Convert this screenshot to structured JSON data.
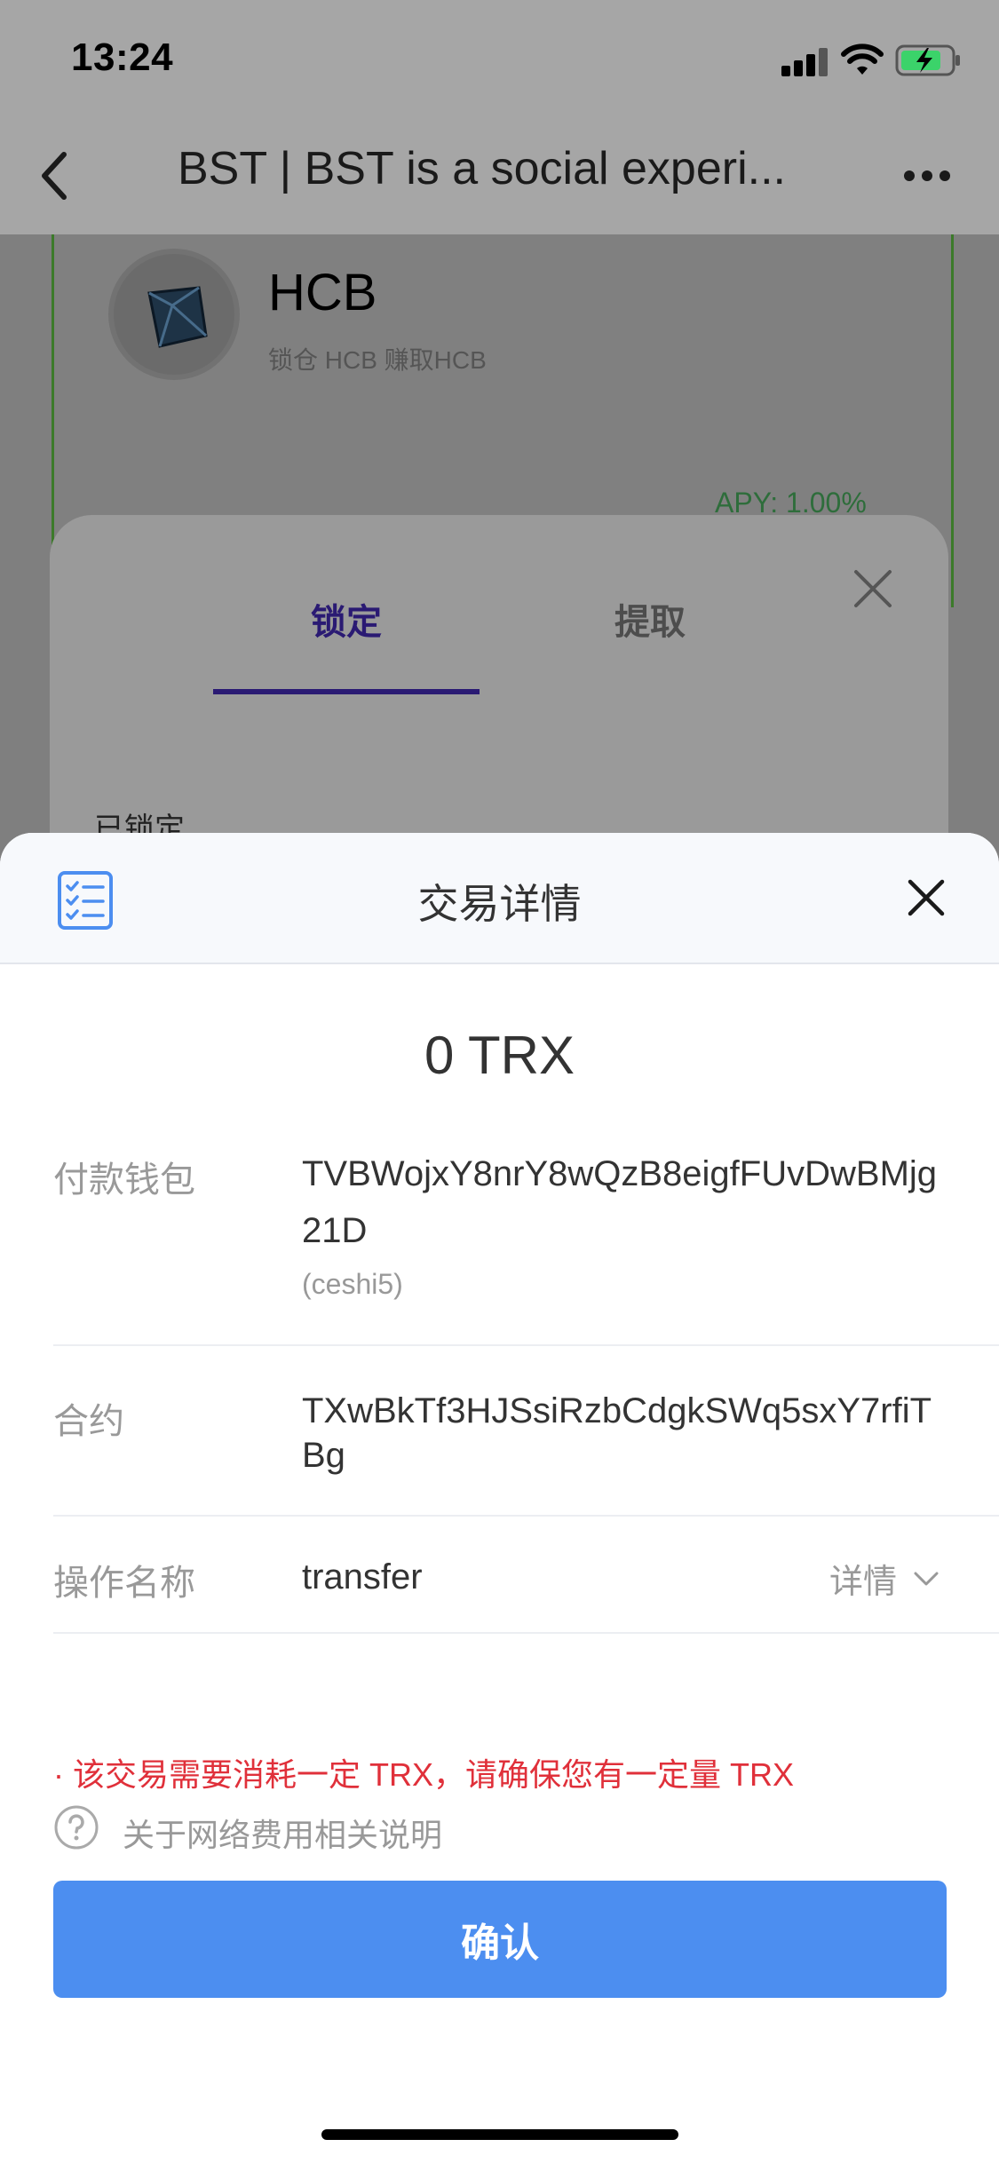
{
  "status_bar": {
    "time": "13:24"
  },
  "nav": {
    "title": "BST | BST is a social experi..."
  },
  "background_page": {
    "coin_name": "HCB",
    "coin_subtitle": "锁仓 HCB 赚取HCB",
    "apy": "APY: 1.00%",
    "tabs": [
      "锁定",
      "提取"
    ],
    "locked_label": "已锁定"
  },
  "sheet": {
    "title": "交易详情",
    "amount": "0 TRX",
    "rows": [
      {
        "label": "付款钱包",
        "value": "TVBWojxY8nrY8wQzB8eigfFUvDwBMjg21D",
        "note": "(ceshi5)"
      },
      {
        "label": "合约",
        "value": "TXwBkTf3HJSsiRzbCdgkSWq5sxY7rfiTBg"
      },
      {
        "label": "操作名称",
        "value": "transfer",
        "action": "详情"
      }
    ],
    "warning": "· 该交易需要消耗一定 TRX，请确保您有一定量 TRX",
    "help_link": "关于网络费用相关说明",
    "confirm_label": "确认"
  },
  "colors": {
    "accent": "#4c8ef0",
    "warning": "#e0303a",
    "tab_active": "#2a1a73"
  }
}
